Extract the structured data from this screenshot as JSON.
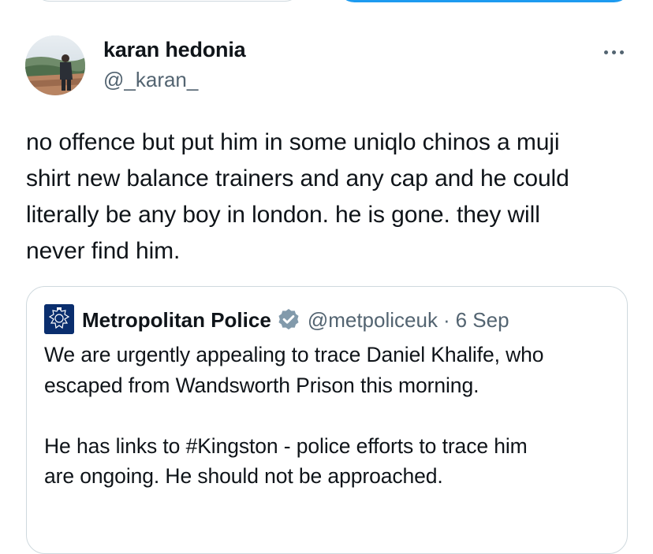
{
  "tweet": {
    "author_name": "karan hedonia",
    "author_handle": "@_karan_",
    "more_icon": "ellipsis-icon",
    "text": "no offence but put him in some uniqlo chinos a muji\nshirt new balance trainers and any cap and he could\nliterally be any boy in london. he is gone. they will\nnever find him."
  },
  "quoted_tweet": {
    "author_name": "Metropolitan Police",
    "verified_icon": "verified-badge-icon",
    "author_handle": "@metpoliceuk",
    "separator": "·",
    "date": "6 Sep",
    "text": "We are urgently appealing to trace Daniel Khalife, who\nescaped from Wandsworth Prison this morning.\n\nHe has links to #Kingston - police efforts to trace him\nare ongoing.  He should not be approached."
  },
  "colors": {
    "primary_text": "#0f1419",
    "secondary_text": "#536471",
    "border": "#cfd9de",
    "accent": "#1d9bf0",
    "police_blue": "#0a2e6e",
    "verified_gray": "#829aab"
  }
}
